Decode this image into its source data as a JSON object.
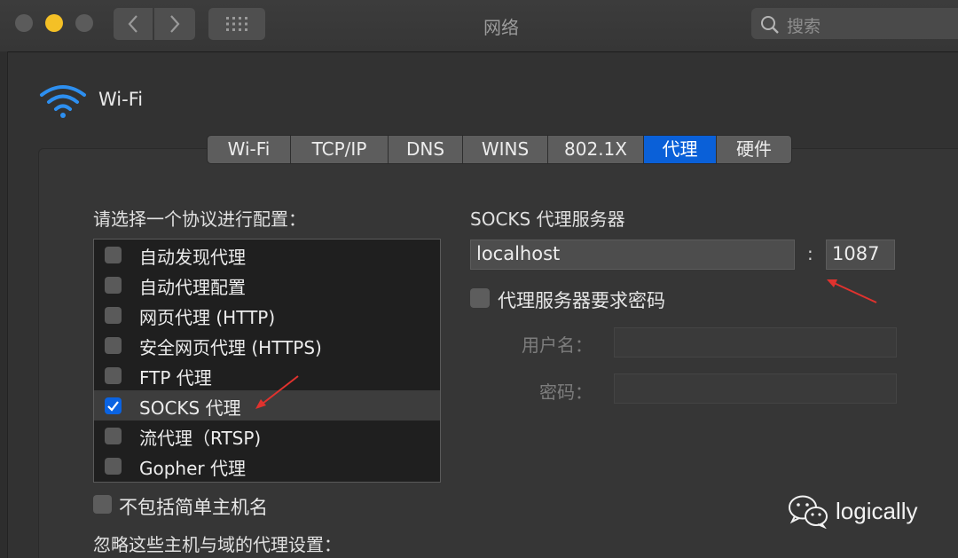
{
  "window": {
    "title": "网络",
    "search_placeholder": "搜索"
  },
  "interface": {
    "name": "Wi-Fi"
  },
  "tabs": [
    {
      "label": "Wi-Fi",
      "active": false
    },
    {
      "label": "TCP/IP",
      "active": false
    },
    {
      "label": "DNS",
      "active": false
    },
    {
      "label": "WINS",
      "active": false
    },
    {
      "label": "802.1X",
      "active": false
    },
    {
      "label": "代理",
      "active": true
    },
    {
      "label": "硬件",
      "active": false
    }
  ],
  "protocols": {
    "heading": "请选择一个协议进行配置：",
    "items": [
      {
        "label": "自动发现代理",
        "checked": false
      },
      {
        "label": "自动代理配置",
        "checked": false
      },
      {
        "label": "网页代理 (HTTP)",
        "checked": false
      },
      {
        "label": "安全网页代理 (HTTPS)",
        "checked": false
      },
      {
        "label": "FTP 代理",
        "checked": false
      },
      {
        "label": "SOCKS 代理",
        "checked": true
      },
      {
        "label": "流代理（RTSP)",
        "checked": false
      },
      {
        "label": "Gopher 代理",
        "checked": false
      }
    ],
    "selected_index": 5
  },
  "exclude_simple_hostnames": {
    "label": "不包括简单主机名",
    "checked": false
  },
  "bypass_heading": "忽略这些主机与域的代理设置：",
  "socks": {
    "heading": "SOCKS 代理服务器",
    "host": "localhost",
    "separator": ":",
    "port": "1087",
    "requires_password": {
      "label": "代理服务器要求密码",
      "checked": false
    },
    "username_label": "用户名：",
    "password_label": "密码："
  },
  "watermark": {
    "text": "logically"
  },
  "colors": {
    "accent": "#0a60d8",
    "annotation_arrow": "#e0322e",
    "traffic_yellow": "#f4c026"
  }
}
